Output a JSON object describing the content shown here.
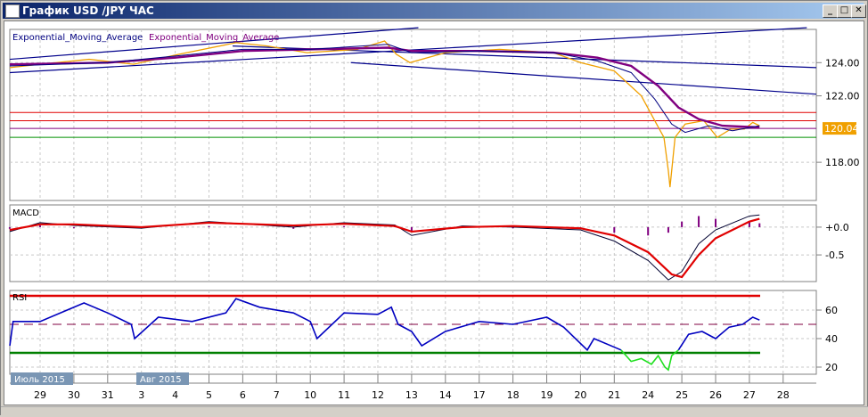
{
  "window": {
    "title": "График USD /JPY  ЧАС",
    "min": "_",
    "max": "□",
    "close": "✕"
  },
  "colors": {
    "price": "#f0a000",
    "ema_fast": "#000080",
    "ema_slow": "#800080",
    "trend": "#00008b",
    "resistance": "#e00000",
    "support": "#009000",
    "macd_signal": "#e00000",
    "macd_line": "#000030",
    "macd_hist": "#800080",
    "rsi": "#0000c0",
    "rsi_low": "#20e020",
    "rsi_upper": "#e00000",
    "rsi_lower": "#008000",
    "rsi_mid": "#800040"
  },
  "chart_data": [
    {
      "type": "line",
      "name": "price",
      "legend": [
        "Exponential_Moving_Average",
        "Exponential_Moving_Average"
      ],
      "current_price": "120.04",
      "y_ticks": [
        "124.00",
        "122.00",
        "118.00"
      ],
      "y_tick_values": [
        124,
        122,
        118
      ],
      "ylim": [
        115.7,
        126.0
      ],
      "xlim": [
        -0.9,
        23.0
      ],
      "series": [
        {
          "name": "price",
          "x": [
            -0.9,
            0,
            1.45,
            2.77,
            4.1,
            5.8,
            6.73,
            7.9,
            9.4,
            10.2,
            10.55,
            10.95,
            12,
            13.6,
            15.2,
            16,
            17,
            17.8,
            18.2,
            18.47,
            18.6,
            18.65,
            18.8,
            19.1,
            19.65,
            20.05,
            20.45,
            20.85,
            21.1,
            21.3
          ],
          "y": [
            123.7,
            123.9,
            124.2,
            123.9,
            124.5,
            125.2,
            125.0,
            124.6,
            124.8,
            125.3,
            124.5,
            124.0,
            124.6,
            124.8,
            124.6,
            124.0,
            123.5,
            122.0,
            120.5,
            119.5,
            117.5,
            116.5,
            119.5,
            120.3,
            120.5,
            119.5,
            120.0,
            120.0,
            120.4,
            120.2
          ]
        },
        {
          "name": "ema_fast",
          "x": [
            -0.9,
            2,
            4,
            6,
            8,
            10.3,
            11,
            13,
            15.2,
            16.5,
            17.5,
            18.2,
            18.7,
            19.1,
            19.8,
            20.5,
            21.3
          ],
          "y": [
            123.8,
            124.0,
            124.4,
            124.8,
            124.8,
            125.1,
            124.6,
            124.7,
            124.6,
            124.1,
            123.4,
            121.8,
            120.3,
            119.8,
            120.2,
            119.9,
            120.2
          ]
        },
        {
          "name": "ema_slow",
          "x": [
            -0.9,
            2,
            4,
            6,
            8,
            10.3,
            11,
            13,
            15.2,
            16.5,
            17.5,
            18.3,
            18.9,
            19.5,
            20.2,
            21.3
          ],
          "y": [
            123.9,
            124.0,
            124.3,
            124.7,
            124.8,
            124.9,
            124.7,
            124.7,
            124.6,
            124.3,
            123.8,
            122.6,
            121.3,
            120.6,
            120.2,
            120.1
          ]
        },
        {
          "name": "trend1",
          "x": [
            -0.9,
            11.2
          ],
          "y": [
            124.2,
            126.1
          ]
        },
        {
          "name": "trend2",
          "x": [
            -0.9,
            22.7
          ],
          "y": [
            123.4,
            126.1
          ]
        },
        {
          "name": "trend3",
          "x": [
            5.7,
            23
          ],
          "y": [
            125.0,
            123.7
          ]
        },
        {
          "name": "trend4",
          "x": [
            9.2,
            23
          ],
          "y": [
            124.0,
            122.1
          ]
        }
      ],
      "levels": [
        {
          "name": "res1",
          "y": 121.0
        },
        {
          "name": "res2",
          "y": 120.5
        },
        {
          "name": "price-line",
          "y": 120.04
        },
        {
          "name": "support",
          "y": 119.5
        }
      ]
    },
    {
      "type": "line",
      "name": "MACD",
      "label": "MACD",
      "y_ticks": [
        "+0.0",
        "-0.5"
      ],
      "y_tick_values": [
        0,
        -0.5
      ],
      "ylim": [
        -0.98,
        0.4
      ],
      "series": [
        {
          "name": "signal",
          "x": [
            -0.9,
            0,
            1,
            3,
            5,
            7.5,
            9,
            10.5,
            11,
            12.5,
            14,
            16,
            17,
            18,
            18.7,
            19,
            19.5,
            20,
            21,
            21.3
          ],
          "y": [
            -0.05,
            0.05,
            0.05,
            0.0,
            0.08,
            0.03,
            0.06,
            0.02,
            -0.08,
            0.0,
            0.02,
            -0.02,
            -0.15,
            -0.45,
            -0.85,
            -0.9,
            -0.5,
            -0.2,
            0.1,
            0.15
          ]
        },
        {
          "name": "macd",
          "x": [
            -0.9,
            0,
            1,
            3,
            5,
            7.5,
            9,
            10.5,
            11,
            12.5,
            14,
            16,
            17,
            18,
            18.6,
            19,
            19.5,
            20,
            21,
            21.3
          ],
          "y": [
            -0.08,
            0.08,
            0.03,
            -0.02,
            0.1,
            0.0,
            0.08,
            0.04,
            -0.15,
            0.02,
            0.0,
            -0.05,
            -0.25,
            -0.6,
            -0.95,
            -0.8,
            -0.3,
            -0.05,
            0.2,
            0.22
          ]
        }
      ]
    },
    {
      "type": "line",
      "name": "RSI",
      "label": "RSI",
      "y_ticks": [
        "60",
        "40",
        "20"
      ],
      "y_tick_values": [
        60,
        40,
        20
      ],
      "ylim": [
        15,
        73.75
      ],
      "levels": [
        70,
        50,
        30
      ],
      "series": [
        {
          "name": "rsi",
          "x": [
            -0.9,
            -0.8,
            0,
            0.8,
            1.3,
            2,
            2.7,
            2.8,
            3.5,
            4.5,
            5.5,
            5.8,
            6.5,
            7.5,
            8,
            8.2,
            9,
            10,
            10.4,
            10.6,
            11,
            11.3,
            12,
            13,
            14,
            15,
            15.5,
            16.2,
            16.4,
            17.2
          ],
          "y": [
            35,
            52,
            52,
            60,
            65,
            58,
            50,
            40,
            55,
            52,
            58,
            68,
            62,
            58,
            52,
            40,
            58,
            57,
            62,
            50,
            45,
            35,
            45,
            52,
            50,
            55,
            48,
            32,
            40,
            32
          ]
        },
        {
          "name": "rsi_low",
          "x": [
            17.2,
            17.5,
            17.8,
            18.1,
            18.3,
            18.5,
            18.6,
            18.7,
            18.9
          ],
          "y": [
            32,
            24,
            26,
            22,
            28,
            20,
            18,
            28,
            32
          ]
        },
        {
          "name": "rsi2",
          "x": [
            18.9,
            19.2,
            19.6,
            20,
            20.4,
            20.8,
            21.1,
            21.3
          ],
          "y": [
            32,
            43,
            45,
            40,
            48,
            50,
            55,
            53
          ]
        }
      ]
    }
  ],
  "x_axis": {
    "months": [
      "Июль 2015",
      "Авг 2015"
    ],
    "days": [
      "29",
      "30",
      "31",
      "3",
      "4",
      "5",
      "6",
      "7",
      "10",
      "11",
      "12",
      "13",
      "14",
      "17",
      "18",
      "19",
      "20",
      "21",
      "24",
      "25",
      "26",
      "27",
      "28"
    ]
  }
}
